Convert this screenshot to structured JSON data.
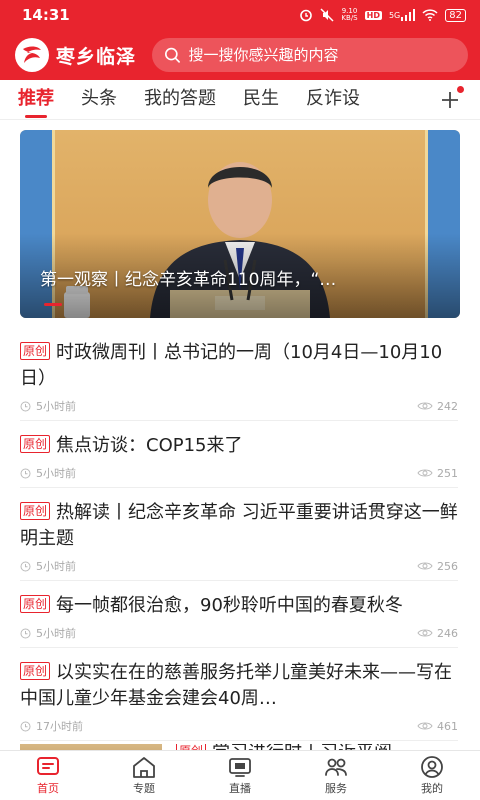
{
  "status_bar": {
    "time": "14:31",
    "net_speed": "9.10\nKB/S",
    "hd": "HD",
    "signal": "5G",
    "battery": "82"
  },
  "header": {
    "app_name": "枣乡临泽",
    "search_placeholder": "搜一搜你感兴趣的内容"
  },
  "tabs": [
    "推荐",
    "头条",
    "我的答题",
    "民生",
    "反诈设"
  ],
  "banner": {
    "caption": "第一观察丨纪念辛亥革命110周年，“…"
  },
  "news": [
    {
      "tag": "原创",
      "title": "时政微周刊丨总书记的一周（10月4日—10月10日）",
      "time": "5小时前",
      "views": "242"
    },
    {
      "tag": "原创",
      "title": "焦点访谈：COP15来了",
      "time": "5小时前",
      "views": "251"
    },
    {
      "tag": "原创",
      "title": "热解读丨纪念辛亥革命 习近平重要讲话贯穿这一鲜明主题",
      "time": "5小时前",
      "views": "256"
    },
    {
      "tag": "原创",
      "title": "每一帧都很治愈，90秒聆听中国的春夏秋冬",
      "time": "5小时前",
      "views": "246"
    },
    {
      "tag": "原创",
      "title": "以实实在在的慈善服务托举儿童美好未来——写在中国儿童少年基金会建会40周…",
      "time": "17小时前",
      "views": "461"
    }
  ],
  "partial_item": {
    "tag": "原创",
    "title": "学习进行时丨习近平阅"
  },
  "bottom_nav": [
    {
      "label": "首页",
      "icon": "home-card-icon"
    },
    {
      "label": "专题",
      "icon": "house-icon"
    },
    {
      "label": "直播",
      "icon": "tv-icon"
    },
    {
      "label": "服务",
      "icon": "people-icon"
    },
    {
      "label": "我的",
      "icon": "user-icon"
    }
  ],
  "colors": {
    "brand": "#e8242e"
  }
}
